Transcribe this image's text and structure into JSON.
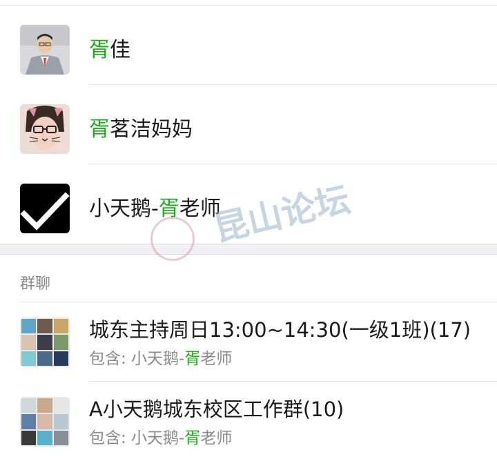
{
  "contacts": [
    {
      "highlight": "胥",
      "name_rest": "佳"
    },
    {
      "highlight": "胥",
      "name_rest": "茗洁妈妈"
    },
    {
      "name_prefix": "小天鹅-",
      "highlight": "胥",
      "name_rest": "老师"
    }
  ],
  "group_section": {
    "title": "群聊",
    "groups": [
      {
        "name": "城东主持周日13:00~14:30(一级1班)(17)",
        "sub_prefix": "包含: 小天鹅-",
        "sub_highlight": "胥",
        "sub_rest": "老师"
      },
      {
        "name": "A小天鹅城东校区工作群(10)",
        "sub_prefix": "包含: 小天鹅-",
        "sub_highlight": "胥",
        "sub_rest": "老师"
      }
    ]
  },
  "watermark": {
    "text": "昆山论坛"
  },
  "colors": {
    "highlight": "#1aad19",
    "secondary_text": "#8a8a8a",
    "divider": "#e2e2e2"
  }
}
